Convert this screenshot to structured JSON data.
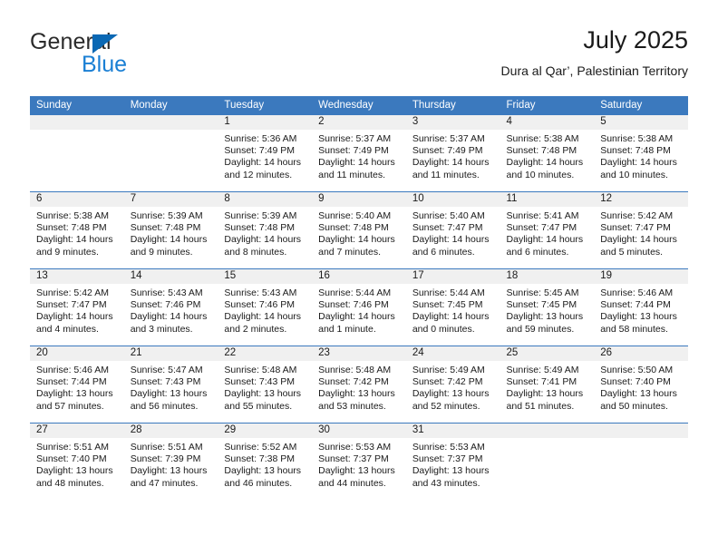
{
  "brand": {
    "name_top": "General",
    "name_bottom": "Blue",
    "triangle_color": "#0a68b4",
    "blue_color": "#1a7fd4"
  },
  "header": {
    "title": "July 2025",
    "subtitle": "Dura al Qar’, Palestinian Territory"
  },
  "theme": {
    "header_blue": "#3b79be",
    "row_strip_gray": "#f0f0f0",
    "text_color": "#1a1a1a"
  },
  "calendar": {
    "weekday_headers": [
      "Sunday",
      "Monday",
      "Tuesday",
      "Wednesday",
      "Thursday",
      "Friday",
      "Saturday"
    ],
    "weeks": [
      [
        {
          "day": "",
          "lines": []
        },
        {
          "day": "",
          "lines": []
        },
        {
          "day": "1",
          "lines": [
            "Sunrise: 5:36 AM",
            "Sunset: 7:49 PM",
            "Daylight: 14 hours",
            "and 12 minutes."
          ]
        },
        {
          "day": "2",
          "lines": [
            "Sunrise: 5:37 AM",
            "Sunset: 7:49 PM",
            "Daylight: 14 hours",
            "and 11 minutes."
          ]
        },
        {
          "day": "3",
          "lines": [
            "Sunrise: 5:37 AM",
            "Sunset: 7:49 PM",
            "Daylight: 14 hours",
            "and 11 minutes."
          ]
        },
        {
          "day": "4",
          "lines": [
            "Sunrise: 5:38 AM",
            "Sunset: 7:48 PM",
            "Daylight: 14 hours",
            "and 10 minutes."
          ]
        },
        {
          "day": "5",
          "lines": [
            "Sunrise: 5:38 AM",
            "Sunset: 7:48 PM",
            "Daylight: 14 hours",
            "and 10 minutes."
          ]
        }
      ],
      [
        {
          "day": "6",
          "lines": [
            "Sunrise: 5:38 AM",
            "Sunset: 7:48 PM",
            "Daylight: 14 hours",
            "and 9 minutes."
          ]
        },
        {
          "day": "7",
          "lines": [
            "Sunrise: 5:39 AM",
            "Sunset: 7:48 PM",
            "Daylight: 14 hours",
            "and 9 minutes."
          ]
        },
        {
          "day": "8",
          "lines": [
            "Sunrise: 5:39 AM",
            "Sunset: 7:48 PM",
            "Daylight: 14 hours",
            "and 8 minutes."
          ]
        },
        {
          "day": "9",
          "lines": [
            "Sunrise: 5:40 AM",
            "Sunset: 7:48 PM",
            "Daylight: 14 hours",
            "and 7 minutes."
          ]
        },
        {
          "day": "10",
          "lines": [
            "Sunrise: 5:40 AM",
            "Sunset: 7:47 PM",
            "Daylight: 14 hours",
            "and 6 minutes."
          ]
        },
        {
          "day": "11",
          "lines": [
            "Sunrise: 5:41 AM",
            "Sunset: 7:47 PM",
            "Daylight: 14 hours",
            "and 6 minutes."
          ]
        },
        {
          "day": "12",
          "lines": [
            "Sunrise: 5:42 AM",
            "Sunset: 7:47 PM",
            "Daylight: 14 hours",
            "and 5 minutes."
          ]
        }
      ],
      [
        {
          "day": "13",
          "lines": [
            "Sunrise: 5:42 AM",
            "Sunset: 7:47 PM",
            "Daylight: 14 hours",
            "and 4 minutes."
          ]
        },
        {
          "day": "14",
          "lines": [
            "Sunrise: 5:43 AM",
            "Sunset: 7:46 PM",
            "Daylight: 14 hours",
            "and 3 minutes."
          ]
        },
        {
          "day": "15",
          "lines": [
            "Sunrise: 5:43 AM",
            "Sunset: 7:46 PM",
            "Daylight: 14 hours",
            "and 2 minutes."
          ]
        },
        {
          "day": "16",
          "lines": [
            "Sunrise: 5:44 AM",
            "Sunset: 7:46 PM",
            "Daylight: 14 hours",
            "and 1 minute."
          ]
        },
        {
          "day": "17",
          "lines": [
            "Sunrise: 5:44 AM",
            "Sunset: 7:45 PM",
            "Daylight: 14 hours",
            "and 0 minutes."
          ]
        },
        {
          "day": "18",
          "lines": [
            "Sunrise: 5:45 AM",
            "Sunset: 7:45 PM",
            "Daylight: 13 hours",
            "and 59 minutes."
          ]
        },
        {
          "day": "19",
          "lines": [
            "Sunrise: 5:46 AM",
            "Sunset: 7:44 PM",
            "Daylight: 13 hours",
            "and 58 minutes."
          ]
        }
      ],
      [
        {
          "day": "20",
          "lines": [
            "Sunrise: 5:46 AM",
            "Sunset: 7:44 PM",
            "Daylight: 13 hours",
            "and 57 minutes."
          ]
        },
        {
          "day": "21",
          "lines": [
            "Sunrise: 5:47 AM",
            "Sunset: 7:43 PM",
            "Daylight: 13 hours",
            "and 56 minutes."
          ]
        },
        {
          "day": "22",
          "lines": [
            "Sunrise: 5:48 AM",
            "Sunset: 7:43 PM",
            "Daylight: 13 hours",
            "and 55 minutes."
          ]
        },
        {
          "day": "23",
          "lines": [
            "Sunrise: 5:48 AM",
            "Sunset: 7:42 PM",
            "Daylight: 13 hours",
            "and 53 minutes."
          ]
        },
        {
          "day": "24",
          "lines": [
            "Sunrise: 5:49 AM",
            "Sunset: 7:42 PM",
            "Daylight: 13 hours",
            "and 52 minutes."
          ]
        },
        {
          "day": "25",
          "lines": [
            "Sunrise: 5:49 AM",
            "Sunset: 7:41 PM",
            "Daylight: 13 hours",
            "and 51 minutes."
          ]
        },
        {
          "day": "26",
          "lines": [
            "Sunrise: 5:50 AM",
            "Sunset: 7:40 PM",
            "Daylight: 13 hours",
            "and 50 minutes."
          ]
        }
      ],
      [
        {
          "day": "27",
          "lines": [
            "Sunrise: 5:51 AM",
            "Sunset: 7:40 PM",
            "Daylight: 13 hours",
            "and 48 minutes."
          ]
        },
        {
          "day": "28",
          "lines": [
            "Sunrise: 5:51 AM",
            "Sunset: 7:39 PM",
            "Daylight: 13 hours",
            "and 47 minutes."
          ]
        },
        {
          "day": "29",
          "lines": [
            "Sunrise: 5:52 AM",
            "Sunset: 7:38 PM",
            "Daylight: 13 hours",
            "and 46 minutes."
          ]
        },
        {
          "day": "30",
          "lines": [
            "Sunrise: 5:53 AM",
            "Sunset: 7:37 PM",
            "Daylight: 13 hours",
            "and 44 minutes."
          ]
        },
        {
          "day": "31",
          "lines": [
            "Sunrise: 5:53 AM",
            "Sunset: 7:37 PM",
            "Daylight: 13 hours",
            "and 43 minutes."
          ]
        },
        {
          "day": "",
          "lines": []
        },
        {
          "day": "",
          "lines": []
        }
      ]
    ]
  }
}
